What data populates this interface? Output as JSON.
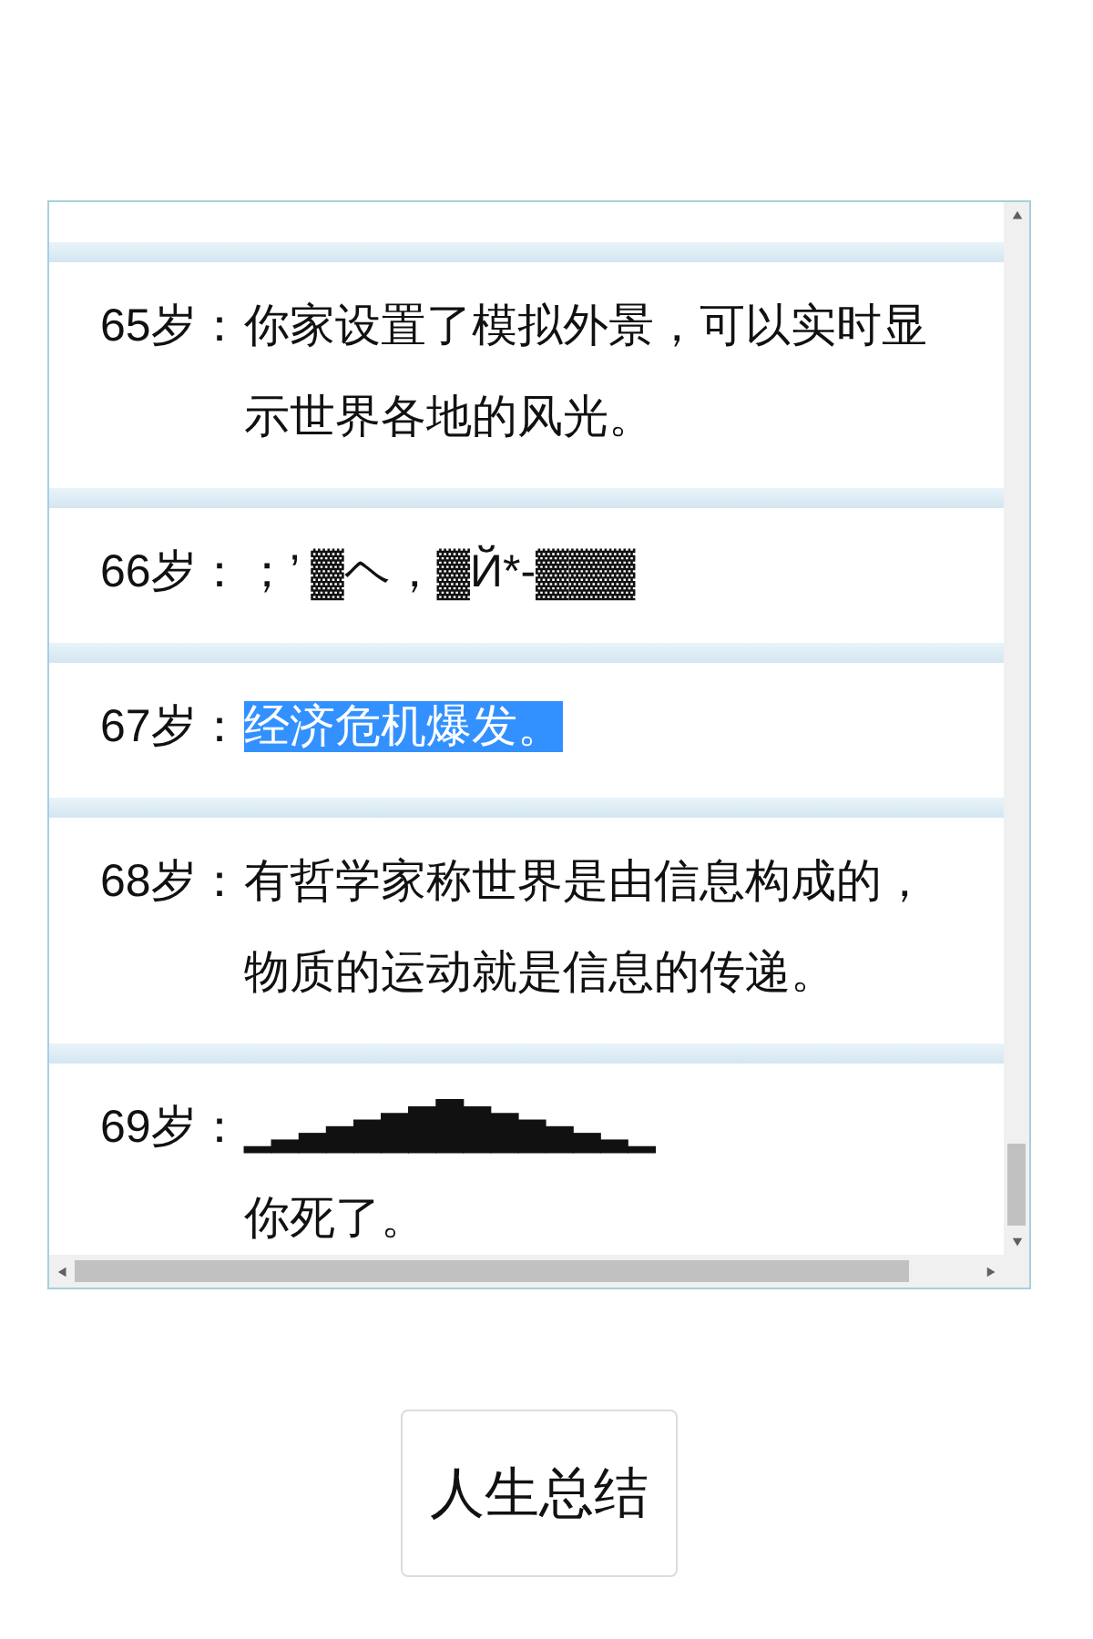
{
  "entries": [
    {
      "age": "65岁：",
      "lines": [
        "你家设置了模拟外景，可以实时显示世界各地的风光。"
      ],
      "highlighted": false
    },
    {
      "age": "66岁：",
      "lines": [
        "；’ ▓ヘ，▓Й*-▓▓▓"
      ],
      "highlighted": false
    },
    {
      "age": "67岁：",
      "lines": [
        "经济危机爆发。"
      ],
      "highlighted": true
    },
    {
      "age": "68岁：",
      "lines": [
        "有哲学家称世界是由信息构成的，物质的运动就是信息的传递。"
      ],
      "highlighted": false
    },
    {
      "age": "69岁：",
      "lines": [
        "▁▂▃▄▅▆▇█▇▆▅▄▃▂▁",
        "你死了。"
      ],
      "highlighted": false
    }
  ],
  "summary_button": {
    "label": "人生总结"
  }
}
